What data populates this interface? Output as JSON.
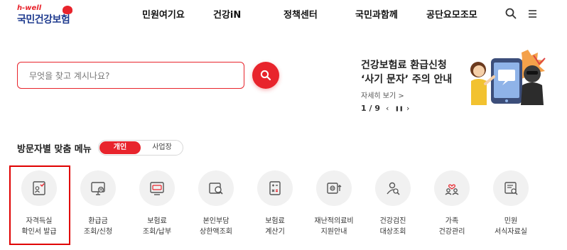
{
  "logo": {
    "small": "h-well",
    "main": "국민건강보험"
  },
  "gnb": [
    "민원여기요",
    "건강iN",
    "정책센터",
    "국민과함께",
    "공단요모조모"
  ],
  "header_icons": [
    "search-icon",
    "menu-icon"
  ],
  "search": {
    "placeholder": "무엇을 찾고 계시나요?"
  },
  "notice": {
    "title_line1": "건강보험료 환급신청",
    "title_line2": "‘사기 문자’ 주의 안내",
    "more": "자세히 보기 >",
    "page": "1 / 9",
    "prev": "‹",
    "pause": "❚❚",
    "next": "›"
  },
  "menu_section": {
    "title": "방문자별 맞춤 메뉴",
    "tab_personal": "개인",
    "tab_business": "사업장",
    "items": [
      {
        "label": "자격득실\n확인서 발급",
        "icon": "certificate-icon"
      },
      {
        "label": "환급금\n조회/신청",
        "icon": "refund-monitor-icon"
      },
      {
        "label": "보험료\n조회/납부",
        "icon": "premium-payment-icon"
      },
      {
        "label": "본인부담\n상한액조회",
        "icon": "copay-search-icon"
      },
      {
        "label": "보험료\n계산기",
        "icon": "calculator-icon"
      },
      {
        "label": "재난적의료비\n지원안내",
        "icon": "medical-support-icon"
      },
      {
        "label": "건강검진\n대상조회",
        "icon": "checkup-search-icon"
      },
      {
        "label": "가족\n건강관리",
        "icon": "family-icon"
      },
      {
        "label": "민원\n서식자료실",
        "icon": "forms-icon"
      }
    ]
  },
  "colors": {
    "accent": "#e8242c",
    "brand_blue": "#1f3b8f",
    "highlight": "#e00000"
  }
}
